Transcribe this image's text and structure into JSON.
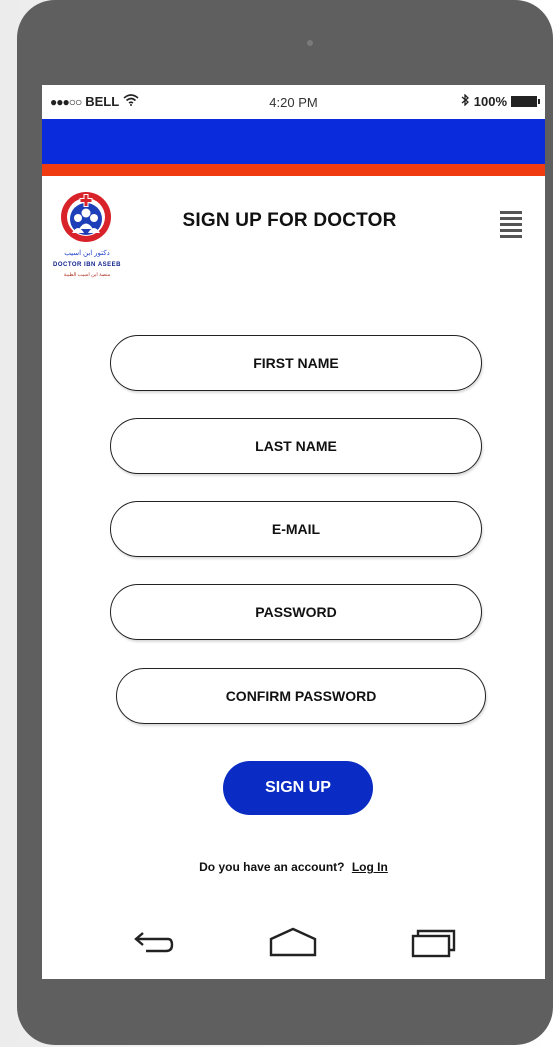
{
  "status": {
    "carrier": "BELL",
    "signal_dots": "●●●○○",
    "time": "4:20 PM",
    "battery": "100%"
  },
  "logo": {
    "arabic_text": "دكتور ابن اسيب",
    "english_text": "DOCTOR IBN ASEEB",
    "tagline": "منصة ابن اسيب الطبية"
  },
  "header": {
    "title": "SIGN UP FOR DOCTOR"
  },
  "form": {
    "first_name": "FIRST NAME",
    "last_name": "LAST NAME",
    "email": "E-MAIL",
    "password": "PASSWORD",
    "confirm_password": "CONFIRM PASSWORD"
  },
  "signup_button": "SIGN UP",
  "account_prompt": "Do you have an account?",
  "login_link": "Log  In",
  "colors": {
    "brand_blue": "#0a2bdc",
    "accent_red": "#ef3b0f",
    "button_blue": "#0a2bc4"
  }
}
